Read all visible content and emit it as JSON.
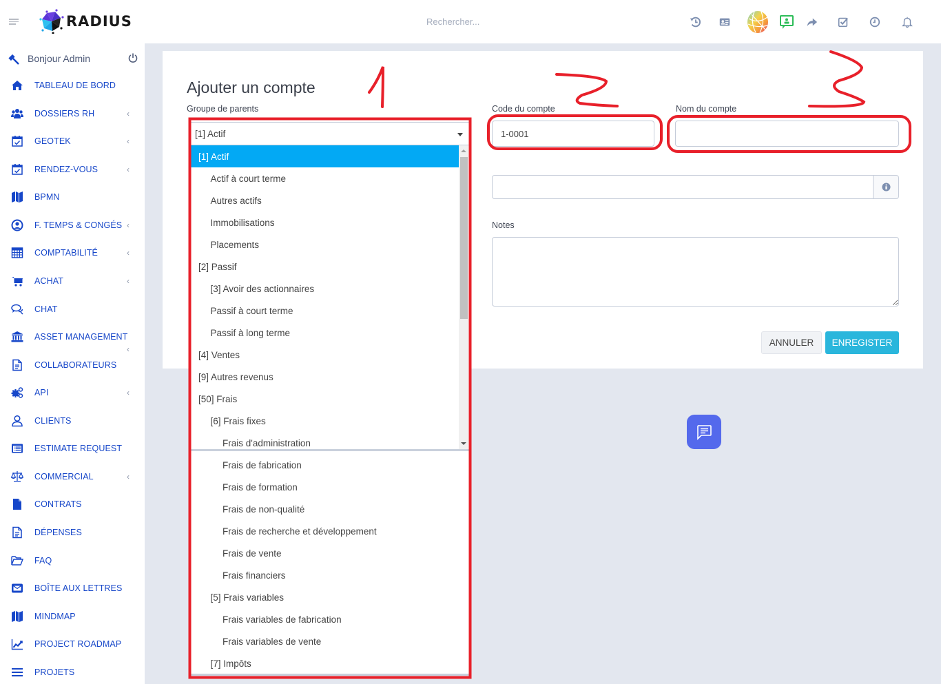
{
  "topbar": {
    "brand": "RADIUS",
    "search_placeholder": "Rechercher...",
    "icons": [
      "history-icon",
      "id-card-icon",
      "globe-logo-icon",
      "presentation-user-icon",
      "share-icon",
      "checkbox-icon",
      "clock-icon",
      "bell-icon"
    ]
  },
  "sidebar": {
    "greeting": "Bonjour Admin",
    "items": [
      {
        "label": "TABLEAU DE BORD",
        "icon": "home-icon",
        "submenu": false
      },
      {
        "label": "DOSSIERS RH",
        "icon": "users-icon",
        "submenu": true
      },
      {
        "label": "GEOTEK",
        "icon": "calendar-check-icon",
        "submenu": true
      },
      {
        "label": "RENDEZ-VOUS",
        "icon": "calendar-check-icon",
        "submenu": true
      },
      {
        "label": "BPMN",
        "icon": "map-icon",
        "submenu": false
      },
      {
        "label": "F. TEMPS & CONGÉS",
        "icon": "user-circle-icon",
        "submenu": true
      },
      {
        "label": "COMPTABILITÉ",
        "icon": "calculator-icon",
        "submenu": true
      },
      {
        "label": "ACHAT",
        "icon": "cart-icon",
        "submenu": true
      },
      {
        "label": "CHAT",
        "icon": "chat-bubbles-icon",
        "submenu": false
      },
      {
        "label": "ASSET MANAGEMENT",
        "icon": "bank-icon",
        "submenu": true
      },
      {
        "label": "COLLABORATEURS",
        "icon": "document-icon",
        "submenu": false
      },
      {
        "label": "API",
        "icon": "cogs-icon",
        "submenu": true
      },
      {
        "label": "CLIENTS",
        "icon": "user-outline-icon",
        "submenu": false
      },
      {
        "label": "ESTIMATE REQUEST",
        "icon": "list-card-icon",
        "submenu": false
      },
      {
        "label": "COMMERCIAL",
        "icon": "balance-scale-icon",
        "submenu": true
      },
      {
        "label": "CONTRATS",
        "icon": "file-icon",
        "submenu": false
      },
      {
        "label": "DÉPENSES",
        "icon": "document-icon",
        "submenu": false
      },
      {
        "label": "FAQ",
        "icon": "folder-open-icon",
        "submenu": false
      },
      {
        "label": "BOÎTE AUX LETTRES",
        "icon": "envelope-icon",
        "submenu": false
      },
      {
        "label": "MINDMAP",
        "icon": "map-icon",
        "submenu": false
      },
      {
        "label": "PROJECT ROADMAP",
        "icon": "line-chart-icon",
        "submenu": false
      },
      {
        "label": "PROJETS",
        "icon": "bars-icon",
        "submenu": false
      }
    ]
  },
  "form": {
    "title": "Ajouter un compte",
    "parent_group_label": "Groupe de parents",
    "parent_group_value": "[1] Actif",
    "account_code_label": "Code du compte",
    "account_code_value": "1-0001",
    "account_name_label": "Nom du compte",
    "account_name_value": "",
    "extra_field_value": "",
    "notes_label": "Notes",
    "notes_value": "",
    "cancel_label": "ANNULER",
    "save_label": "ENREGISTER"
  },
  "dropdown": {
    "options": [
      {
        "label": "[1] Actif",
        "level": 0,
        "selected": true
      },
      {
        "label": "Actif à court terme",
        "level": 1
      },
      {
        "label": "Autres actifs",
        "level": 1
      },
      {
        "label": "Immobilisations",
        "level": 1
      },
      {
        "label": "Placements",
        "level": 1
      },
      {
        "label": "[2] Passif",
        "level": 0
      },
      {
        "label": "[3] Avoir des actionnaires",
        "level": 1
      },
      {
        "label": "Passif à court terme",
        "level": 1
      },
      {
        "label": "Passif à long terme",
        "level": 1
      },
      {
        "label": "[4] Ventes",
        "level": 0
      },
      {
        "label": "[9] Autres revenus",
        "level": 0
      },
      {
        "label": "[50] Frais",
        "level": 0
      },
      {
        "label": "[6] Frais fixes",
        "level": 1
      },
      {
        "label": "Frais d'administration",
        "level": 2
      }
    ],
    "overflow_options": [
      {
        "label": "Frais de fabrication",
        "level": 2
      },
      {
        "label": "Frais de formation",
        "level": 2
      },
      {
        "label": "Frais de non-qualité",
        "level": 2
      },
      {
        "label": "Frais de recherche et développement",
        "level": 2
      },
      {
        "label": "Frais de vente",
        "level": 2
      },
      {
        "label": "Frais financiers",
        "level": 2
      },
      {
        "label": "[5] Frais variables",
        "level": 1
      },
      {
        "label": "Frais variables de fabrication",
        "level": 2
      },
      {
        "label": "Frais variables de vente",
        "level": 2
      },
      {
        "label": "[7] Impôts",
        "level": 1
      }
    ]
  },
  "annotations": [
    "1",
    "2",
    "3"
  ],
  "colors": {
    "accent": "#1747c9",
    "selected_option": "#03a9f4",
    "save_button": "#2ab6dc",
    "annotation_red": "#e8202a",
    "chat_fab": "#5469ec"
  }
}
